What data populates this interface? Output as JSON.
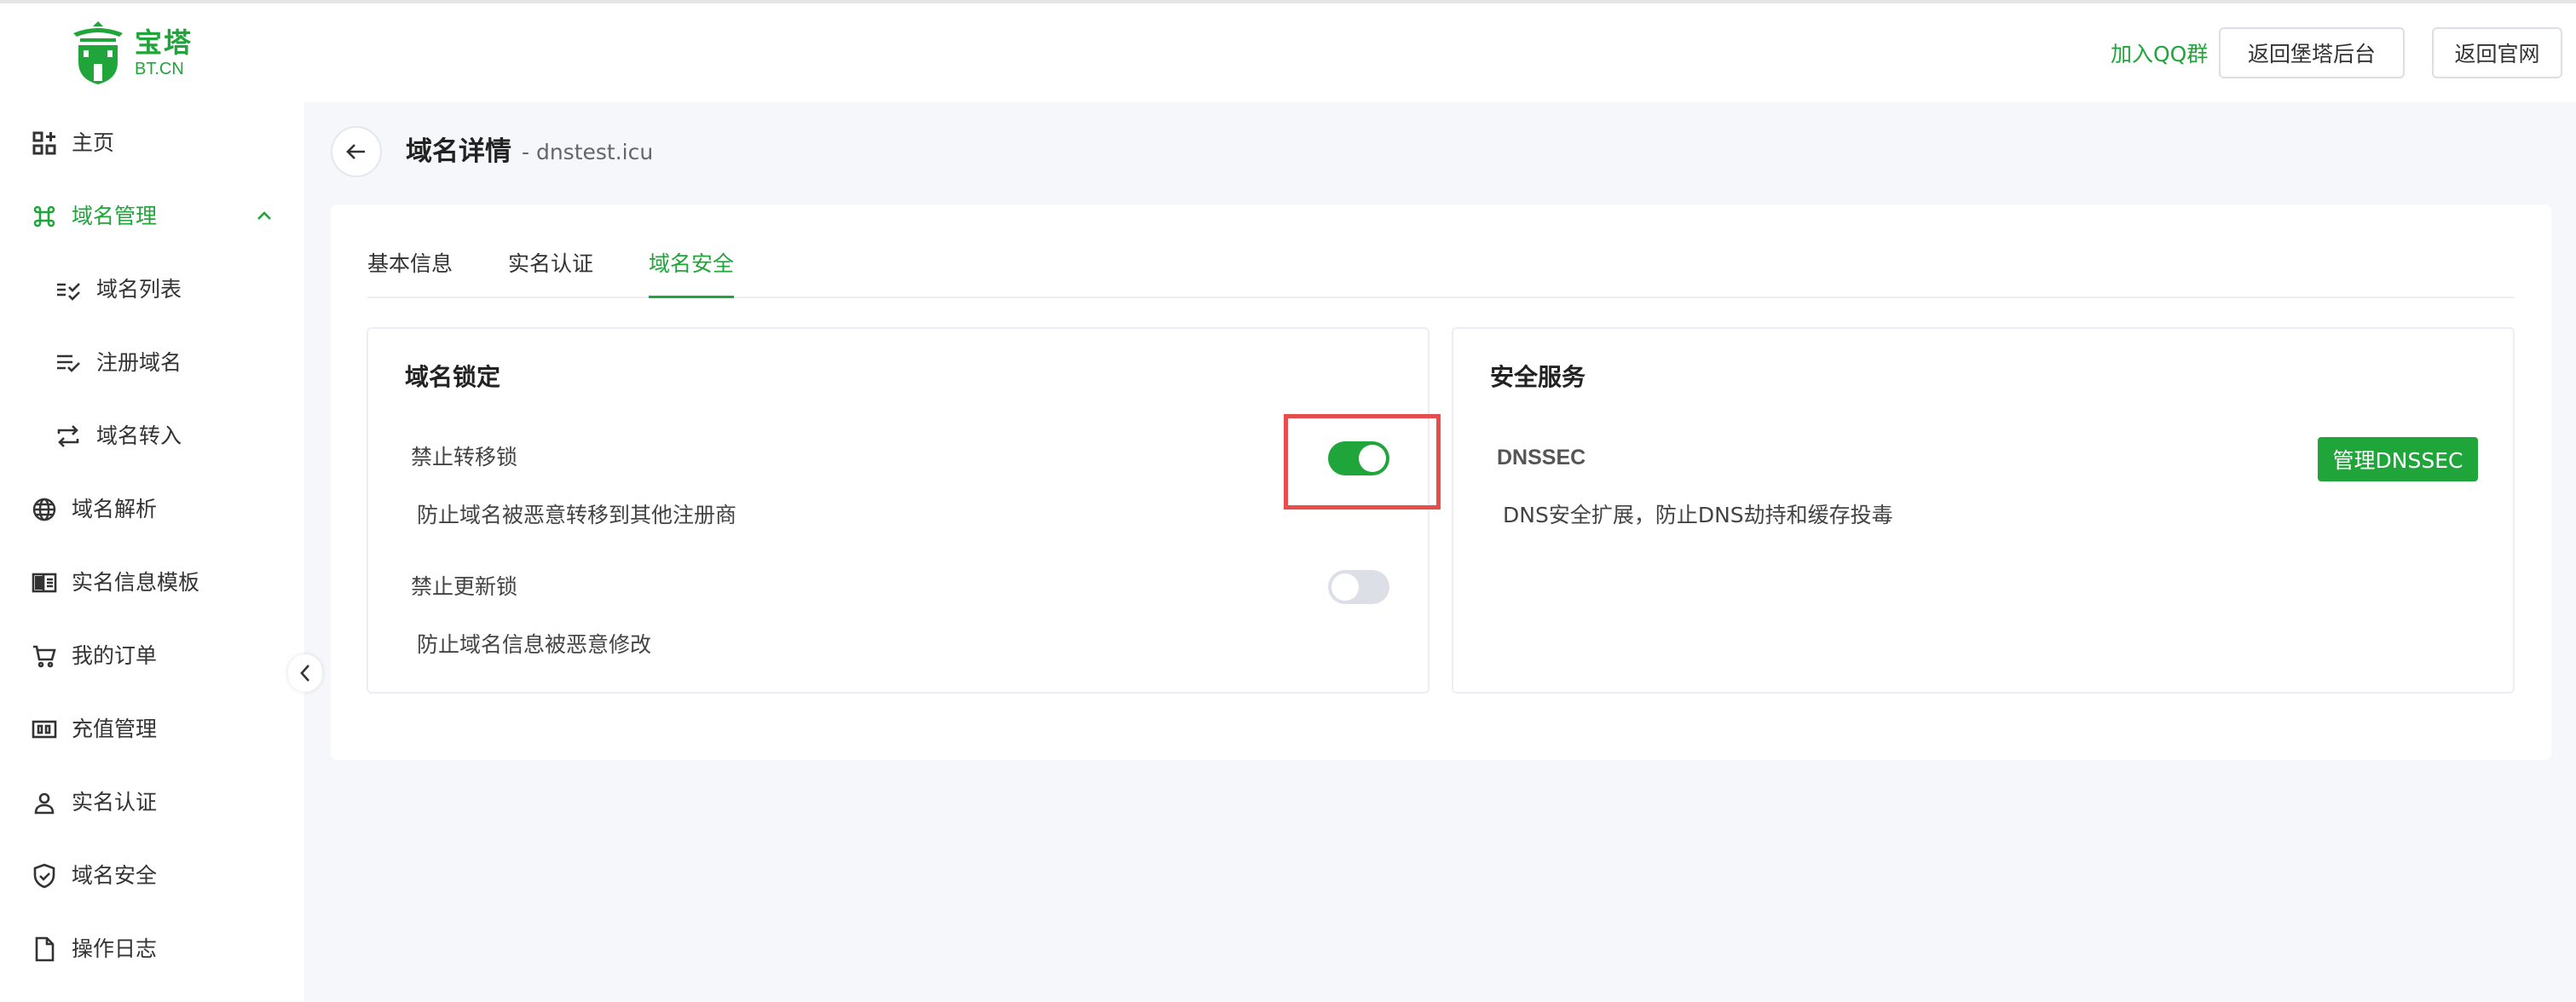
{
  "header": {
    "logo_cn": "宝塔",
    "logo_en": "BT.CN",
    "qq_group": "加入QQ群",
    "back_panel": "返回堡塔后台",
    "back_site": "返回官网"
  },
  "sidebar": {
    "items": [
      {
        "label": "主页",
        "icon": "dashboard-icon"
      },
      {
        "label": "域名管理",
        "icon": "command-icon",
        "active": true,
        "expanded": true
      },
      {
        "label": "域名列表",
        "icon": "list-check-icon"
      },
      {
        "label": "注册域名",
        "icon": "list-add-icon"
      },
      {
        "label": "域名转入",
        "icon": "transfer-icon"
      },
      {
        "label": "域名解析",
        "icon": "globe-icon"
      },
      {
        "label": "实名信息模板",
        "icon": "template-icon"
      },
      {
        "label": "我的订单",
        "icon": "cart-icon"
      },
      {
        "label": "充值管理",
        "icon": "recharge-icon"
      },
      {
        "label": "实名认证",
        "icon": "user-icon"
      },
      {
        "label": "域名安全",
        "icon": "shield-icon"
      },
      {
        "label": "操作日志",
        "icon": "document-icon"
      }
    ]
  },
  "page": {
    "title": "域名详情",
    "subtitle": "- dnstest.icu"
  },
  "tabs": [
    {
      "label": "基本信息"
    },
    {
      "label": "实名认证"
    },
    {
      "label": "域名安全",
      "active": true
    }
  ],
  "lock_panel": {
    "title": "域名锁定",
    "transfer_lock_label": "禁止转移锁",
    "transfer_lock_desc": "防止域名被恶意转移到其他注册商",
    "transfer_lock_on": true,
    "update_lock_label": "禁止更新锁",
    "update_lock_desc": "防止域名信息被恶意修改",
    "update_lock_on": false
  },
  "security_panel": {
    "title": "安全服务",
    "dnssec_label": "DNSSEC",
    "dnssec_button": "管理DNSSEC",
    "dnssec_desc": "DNS安全扩展，防止DNS劫持和缓存投毒"
  },
  "colors": {
    "accent": "#20a53a",
    "highlight": "#e84d4d"
  }
}
